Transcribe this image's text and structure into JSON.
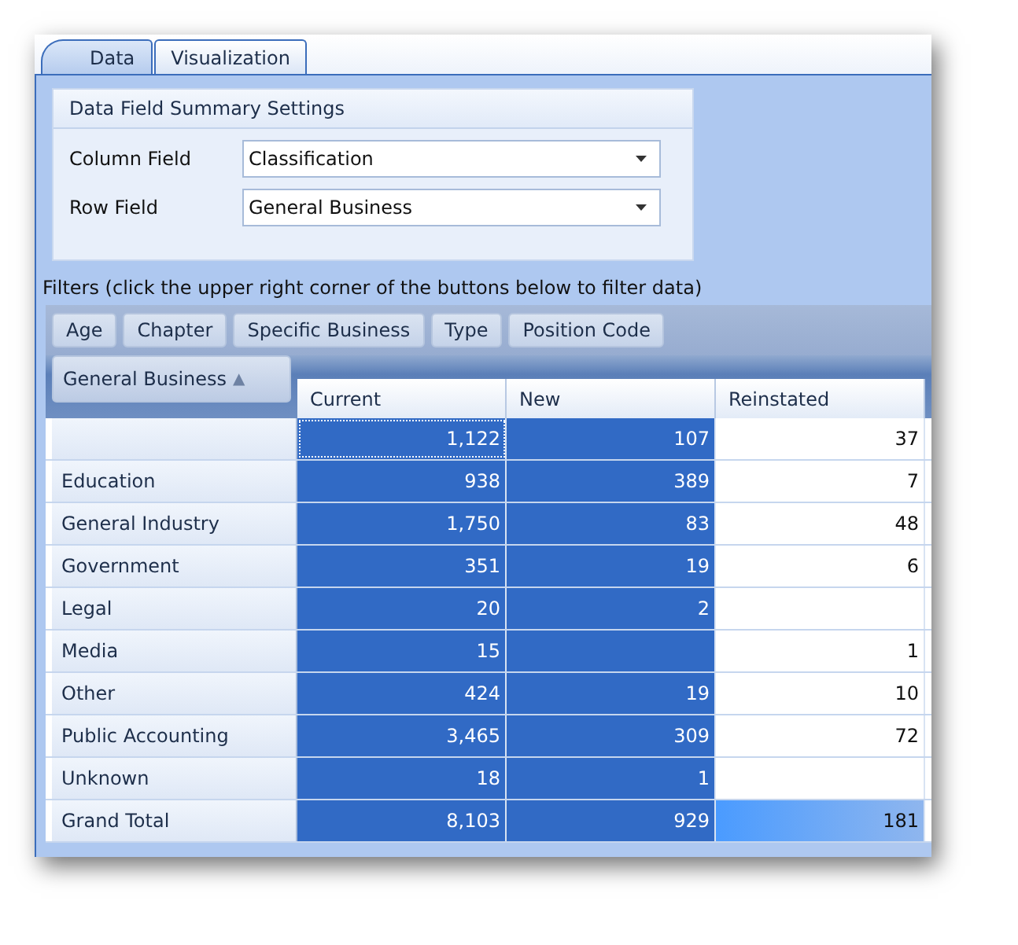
{
  "tabs": [
    {
      "label": "Data",
      "selected": true
    },
    {
      "label": "Visualization",
      "selected": false
    }
  ],
  "settings": {
    "title": "Data Field Summary Settings",
    "fields": [
      {
        "label": "Column Field",
        "value": "Classification"
      },
      {
        "label": "Row Field",
        "value": "General Business"
      }
    ]
  },
  "filters_hint": "Filters (click the upper right corner of the buttons below to filter data)",
  "filter_buttons": [
    "Age",
    "Chapter",
    "Specific Business",
    "Type",
    "Position Code"
  ],
  "row_field_button": {
    "label": "General Business",
    "sort_icon": "▲"
  },
  "columns": [
    "Current",
    "New",
    "Reinstated"
  ],
  "rows": [
    {
      "cells": [
        {
          "value": "1,122",
          "kind": "focused"
        },
        {
          "value": "107",
          "kind": "selected"
        },
        {
          "value": "37",
          "kind": "plain"
        }
      ]
    },
    {
      "label": "Education",
      "cells": [
        {
          "value": "938",
          "kind": "selected"
        },
        {
          "value": "389",
          "kind": "selected"
        },
        {
          "value": "7",
          "kind": "plain"
        }
      ]
    },
    {
      "label": "General Industry",
      "cells": [
        {
          "value": "1,750",
          "kind": "selected"
        },
        {
          "value": "83",
          "kind": "selected"
        },
        {
          "value": "48",
          "kind": "plain"
        }
      ]
    },
    {
      "label": "Government",
      "cells": [
        {
          "value": "351",
          "kind": "selected"
        },
        {
          "value": "19",
          "kind": "selected"
        },
        {
          "value": "6",
          "kind": "plain"
        }
      ]
    },
    {
      "label": "Legal",
      "cells": [
        {
          "value": "20",
          "kind": "selected"
        },
        {
          "value": "2",
          "kind": "selected"
        },
        {
          "kind": "plain"
        }
      ]
    },
    {
      "label": "Media",
      "cells": [
        {
          "value": "15",
          "kind": "selected"
        },
        {
          "kind": "selected"
        },
        {
          "value": "1",
          "kind": "plain"
        }
      ]
    },
    {
      "label": "Other",
      "cells": [
        {
          "value": "424",
          "kind": "selected"
        },
        {
          "value": "19",
          "kind": "selected"
        },
        {
          "value": "10",
          "kind": "plain"
        }
      ]
    },
    {
      "label": "Public Accounting",
      "cells": [
        {
          "value": "3,465",
          "kind": "selected"
        },
        {
          "value": "309",
          "kind": "selected"
        },
        {
          "value": "72",
          "kind": "plain"
        }
      ]
    },
    {
      "label": "Unknown",
      "cells": [
        {
          "value": "18",
          "kind": "selected"
        },
        {
          "value": "1",
          "kind": "selected"
        },
        {
          "kind": "plain"
        }
      ]
    },
    {
      "label": "Grand Total",
      "cells": [
        {
          "value": "8,103",
          "kind": "selected"
        },
        {
          "value": "929",
          "kind": "selected"
        },
        {
          "value": "181",
          "kind": "hot"
        }
      ]
    }
  ]
}
